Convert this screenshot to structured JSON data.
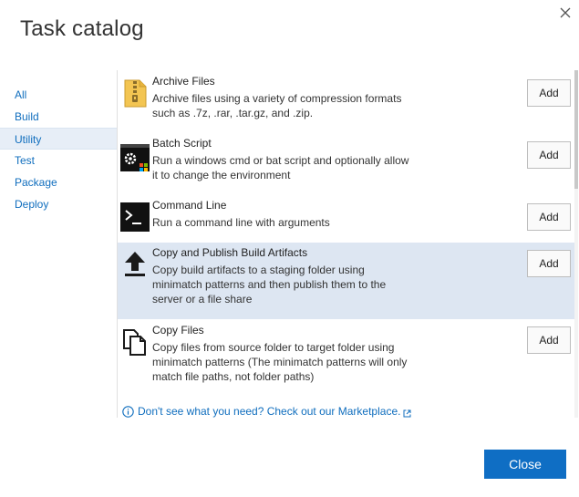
{
  "dialog": {
    "title": "Task catalog",
    "close_icon": "close-x-icon"
  },
  "categories": [
    {
      "label": "All",
      "selected": false
    },
    {
      "label": "Build",
      "selected": false
    },
    {
      "label": "Utility",
      "selected": true
    },
    {
      "label": "Test",
      "selected": false
    },
    {
      "label": "Package",
      "selected": false
    },
    {
      "label": "Deploy",
      "selected": false
    }
  ],
  "tasks": [
    {
      "icon": "archive-zip-icon",
      "name": "Archive Files",
      "description": "Archive files using a variety of compression formats such as .7z, .rar, .tar.gz, and .zip.",
      "add_label": "Add",
      "selected": false
    },
    {
      "icon": "batch-script-icon",
      "name": "Batch Script",
      "description": "Run a windows cmd or bat script and optionally allow it to change the environment",
      "add_label": "Add",
      "selected": false
    },
    {
      "icon": "command-line-icon",
      "name": "Command Line",
      "description": "Run a command line with arguments",
      "add_label": "Add",
      "selected": false
    },
    {
      "icon": "upload-arrow-icon",
      "name": "Copy and Publish Build Artifacts",
      "description": "Copy build artifacts to a staging folder using minimatch patterns and then publish them to the server or a file share",
      "add_label": "Add",
      "selected": true
    },
    {
      "icon": "copy-files-icon",
      "name": "Copy Files",
      "description": "Copy files from source folder to target folder using minimatch patterns (The minimatch patterns will only match file paths, not folder paths)",
      "add_label": "Add",
      "selected": false
    }
  ],
  "marketplace": {
    "text": "Don't see what you need? Check out our Marketplace.",
    "info_icon": "info-icon",
    "external_icon": "external-link-icon"
  },
  "footer": {
    "close_label": "Close"
  },
  "colors": {
    "accent": "#0f6ec4",
    "link": "#106ebe",
    "selected_row": "#dde6f2",
    "selected_category": "#e7eef7"
  }
}
